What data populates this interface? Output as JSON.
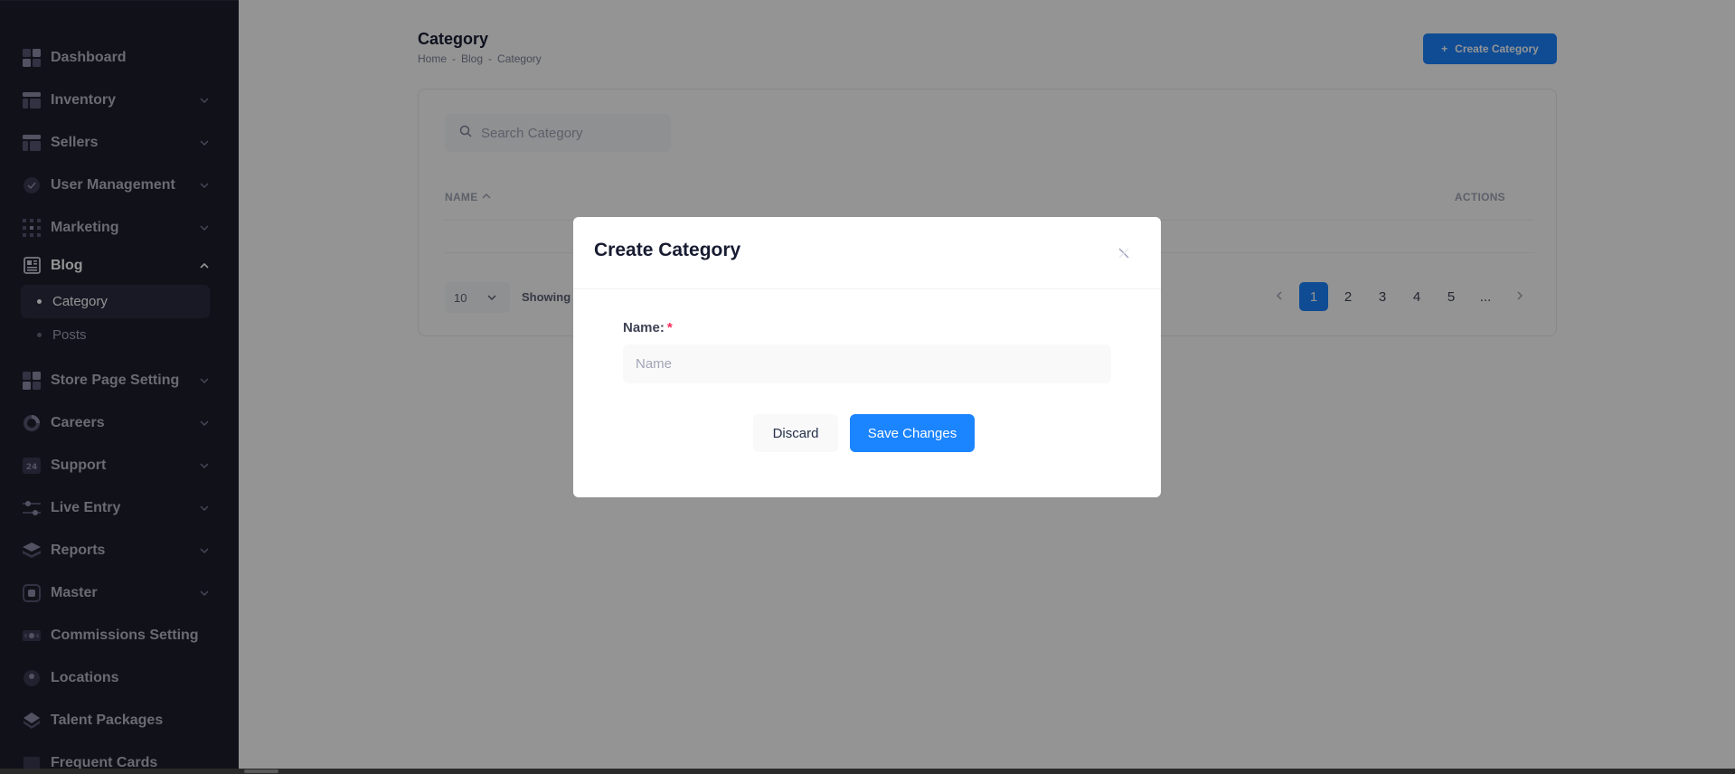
{
  "sidebar": {
    "items": [
      {
        "label": "Dashboard",
        "icon": "dashboard-icon",
        "chevron": false
      },
      {
        "label": "Inventory",
        "icon": "layout-icon",
        "chevron": true
      },
      {
        "label": "Sellers",
        "icon": "layout-icon",
        "chevron": true
      },
      {
        "label": "User Management",
        "icon": "shield-icon",
        "chevron": true
      },
      {
        "label": "Marketing",
        "icon": "grid-dots-icon",
        "chevron": true
      },
      {
        "label": "Blog",
        "icon": "newspaper-icon",
        "chevron": true,
        "expanded": true,
        "children": [
          {
            "label": "Category",
            "active": true
          },
          {
            "label": "Posts",
            "active": false
          }
        ]
      },
      {
        "label": "Store Page Setting",
        "icon": "dashboard-icon",
        "chevron": true
      },
      {
        "label": "Careers",
        "icon": "donut-icon",
        "chevron": true
      },
      {
        "label": "Support",
        "icon": "support-24-icon",
        "chevron": true
      },
      {
        "label": "Live Entry",
        "icon": "sliders-icon",
        "chevron": true
      },
      {
        "label": "Reports",
        "icon": "layers-icon",
        "chevron": true
      },
      {
        "label": "Master",
        "icon": "frame-icon",
        "chevron": true
      },
      {
        "label": "Commissions Setting",
        "icon": "money-icon",
        "chevron": false
      },
      {
        "label": "Locations",
        "icon": "map-pin-icon",
        "chevron": false
      },
      {
        "label": "Talent Packages",
        "icon": "package-icon",
        "chevron": false
      },
      {
        "label": "Frequent Cards",
        "icon": "cards-icon",
        "chevron": false
      }
    ],
    "support_icon_text": "24"
  },
  "header": {
    "title": "Category",
    "breadcrumb": [
      "Home",
      "Blog",
      "Category"
    ],
    "breadcrumb_sep": "-",
    "create_button_label": "Create Category",
    "create_button_icon": "+"
  },
  "table": {
    "search_placeholder": "Search Category",
    "columns": {
      "name": "NAME",
      "actions": "ACTIONS"
    },
    "page_size": "10",
    "showing_text": "Showing"
  },
  "pagination": {
    "pages": [
      "1",
      "2",
      "3",
      "4",
      "5"
    ],
    "ellipsis": "...",
    "current": "1"
  },
  "modal": {
    "title": "Create Category",
    "field_label": "Name:",
    "required_mark": "*",
    "input_placeholder": "Name",
    "input_value": "",
    "discard_label": "Discard",
    "save_label": "Save Changes"
  },
  "colors": {
    "accent": "#1b84ff",
    "sidebar_bg": "#1e1e2d",
    "required": "#f8285a"
  }
}
